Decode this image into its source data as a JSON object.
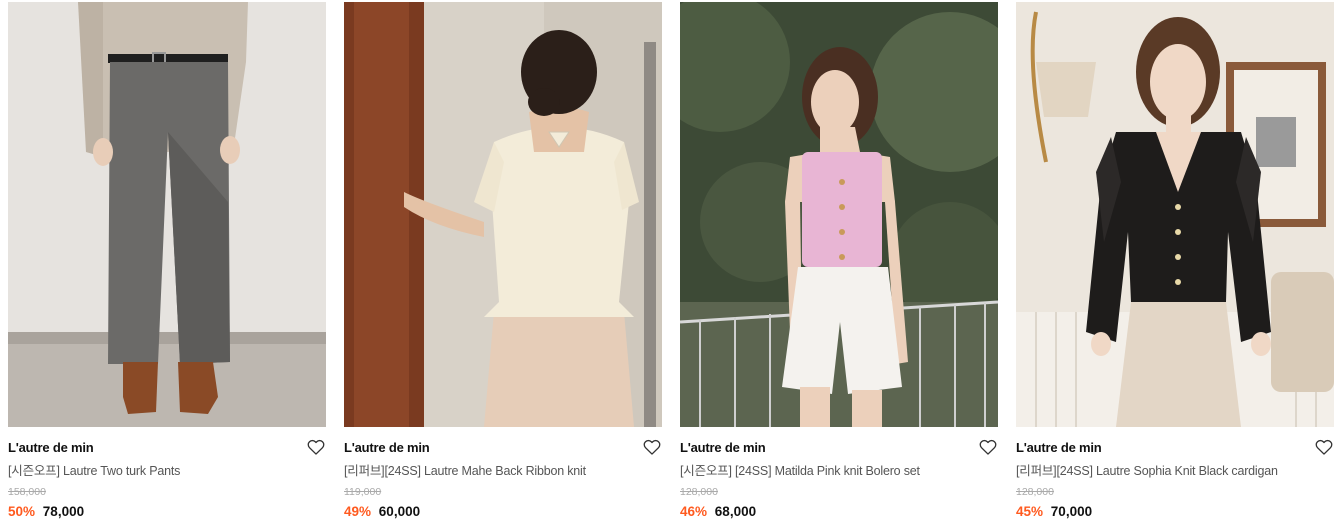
{
  "products": [
    {
      "brand": "L'autre de min",
      "title": "[시즌오프] Lautre Two turk Pants",
      "original_price": "158,000",
      "discount": "50%",
      "price": "78,000",
      "image_icon": "product-photo"
    },
    {
      "brand": "L'autre de min",
      "title": "[리퍼브][24SS] Lautre Mahe Back Ribbon knit",
      "original_price": "119,000",
      "discount": "49%",
      "price": "60,000",
      "image_icon": "product-photo"
    },
    {
      "brand": "L'autre de min",
      "title": "[시즌오프] [24SS] Matilda Pink knit Bolero set",
      "original_price": "128,000",
      "discount": "46%",
      "price": "68,000",
      "image_icon": "product-photo"
    },
    {
      "brand": "L'autre de min",
      "title": "[리퍼브][24SS] Lautre Sophia Knit Black cardigan",
      "original_price": "128,000",
      "discount": "45%",
      "price": "70,000",
      "image_icon": "product-photo"
    }
  ],
  "colors": {
    "discount": "#ff5a1f",
    "brand_text": "#111111",
    "title_text": "#555555",
    "original_price": "#aaaaaa"
  },
  "icons": {
    "wishlist": "heart-outline-icon"
  }
}
